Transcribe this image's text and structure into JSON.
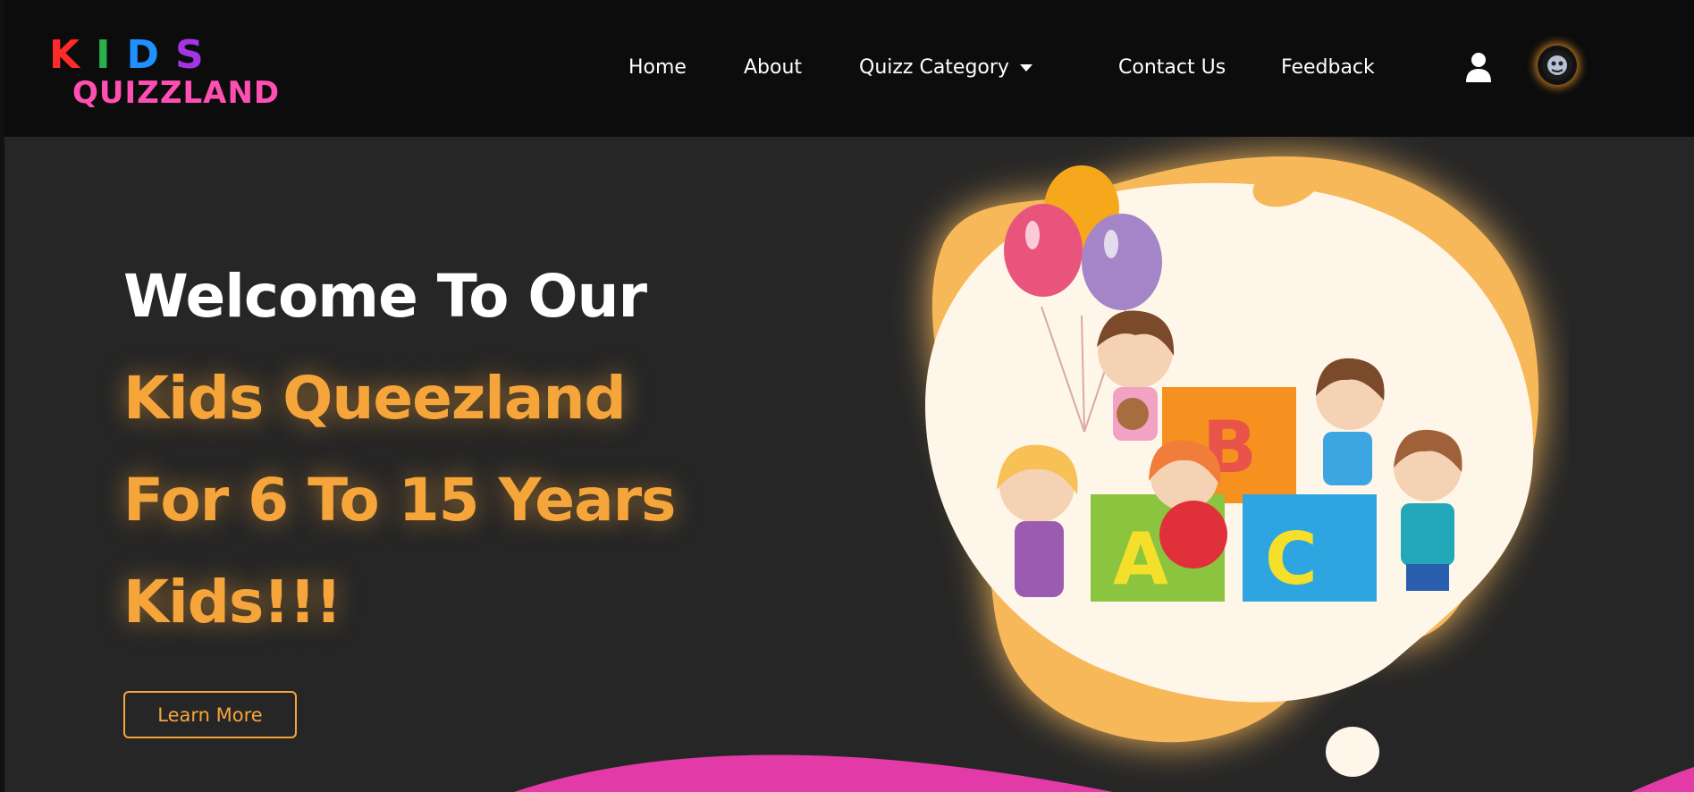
{
  "brand": {
    "logo_top": [
      "K",
      "I",
      "D",
      "S"
    ],
    "logo_bottom": "QUIZZLAND",
    "colors": {
      "k": "#ff2a2a",
      "i": "#2ab04a",
      "d": "#1e90ff",
      "s": "#a335e6",
      "quizz": "#ff4fb3"
    }
  },
  "nav": {
    "items": [
      {
        "label": "Home"
      },
      {
        "label": "About"
      },
      {
        "label": "Quizz Category",
        "dropdown": true
      },
      {
        "label": "Contact Us"
      },
      {
        "label": "Feedback"
      }
    ],
    "user_icon": "user-icon",
    "avatar_icon": "avatar-icon"
  },
  "hero": {
    "line1": "Welcome To Our",
    "line2": "Kids Queezland",
    "line3": "For 6 To 15 Years",
    "line4": "Kids!!!",
    "cta_label": "Learn More",
    "illustration_icon": "kids-with-abc-blocks-illustration"
  },
  "theme": {
    "background": "#262626",
    "navbar": "#0c0c0c",
    "accent_orange": "#f6a53a",
    "accent_pink": "#e23aa7",
    "blob_orange": "#f7b85a",
    "blob_cream": "#fff6ea"
  }
}
